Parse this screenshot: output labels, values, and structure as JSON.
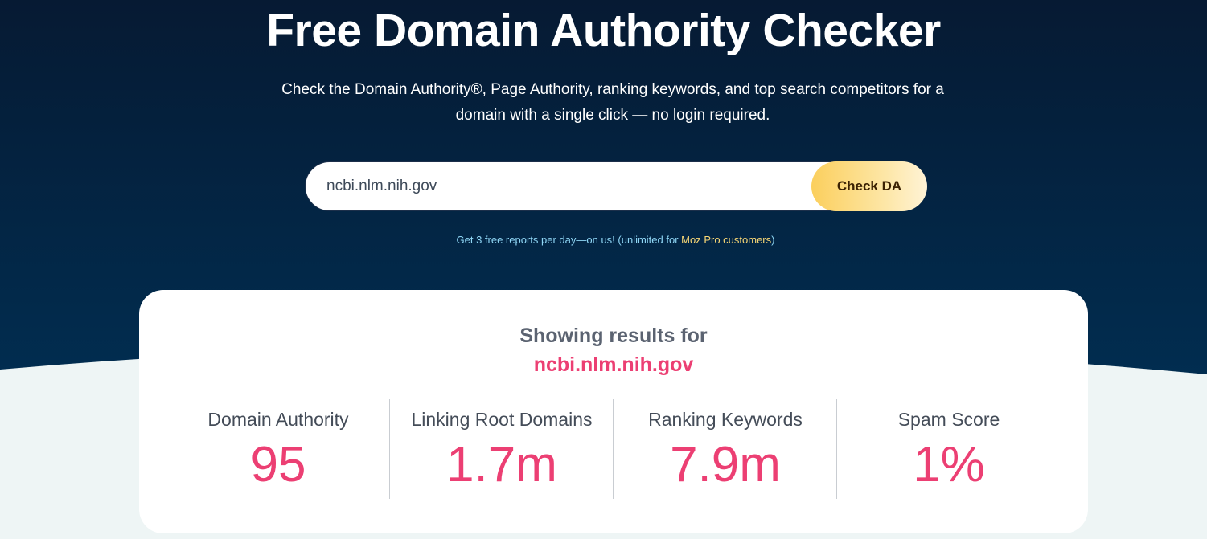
{
  "hero": {
    "title": "Free Domain Authority Checker",
    "subtitle": "Check the Domain Authority®, Page Authority, ranking keywords, and top search competitors for a domain with a single click — no login required."
  },
  "search": {
    "value": "ncbi.nlm.nih.gov",
    "button_label": "Check DA"
  },
  "note": {
    "prefix": "Get 3 free reports per day—on us! (unlimited for ",
    "link_text": "Moz Pro customers",
    "suffix": ")"
  },
  "results": {
    "heading": "Showing results for",
    "domain": "ncbi.nlm.nih.gov",
    "metrics": [
      {
        "label": "Domain Authority",
        "value": "95"
      },
      {
        "label": "Linking Root Domains",
        "value": "1.7m"
      },
      {
        "label": "Ranking Keywords",
        "value": "7.9m"
      },
      {
        "label": "Spam Score",
        "value": "1%"
      }
    ]
  },
  "colors": {
    "hero_top": "#061a33",
    "hero_bottom": "#012d50",
    "accent_pink": "#ec3f73",
    "button_yellow": "#fbcf5d",
    "note_blue": "#8fd6f5",
    "link_yellow": "#f9d775"
  }
}
